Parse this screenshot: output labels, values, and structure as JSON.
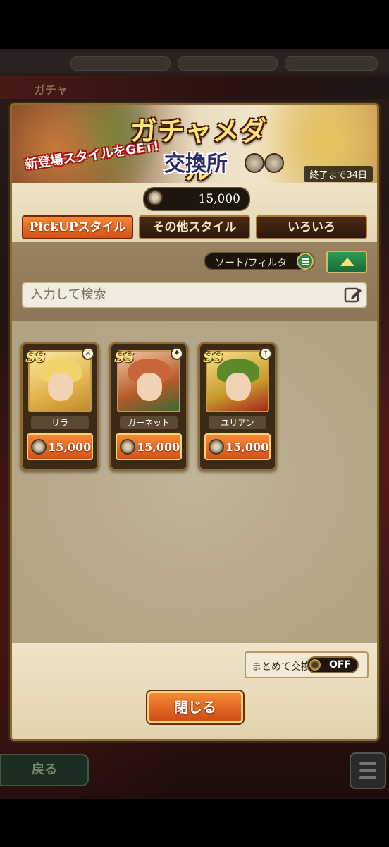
{
  "background": {
    "title": "ガチャ",
    "back_label": "戻る"
  },
  "banner": {
    "title": "ガチャメダル",
    "subtitle": "交換所",
    "promo": "新登場スタイルをGET!",
    "end_label": "終了まで34日"
  },
  "currency": {
    "icon": "medal-icon",
    "value": "15,000"
  },
  "tabs": [
    {
      "label": "PickUPスタイル",
      "active": true
    },
    {
      "label": "その他スタイル",
      "active": false
    },
    {
      "label": "いろいろ",
      "active": false
    }
  ],
  "filter": {
    "sort_label": "ソート/フィルタ",
    "search_placeholder": "入力して検索"
  },
  "items": [
    {
      "name": "リラ",
      "rank": "SS",
      "price": "15,000",
      "weapon_icon": "fan-icon"
    },
    {
      "name": "ガーネット",
      "rank": "SS",
      "price": "15,000",
      "weapon_icon": "staff-icon"
    },
    {
      "name": "ユリアン",
      "rank": "SS",
      "price": "15,000",
      "weapon_icon": "sword-icon"
    }
  ],
  "footer": {
    "bulk_label": "まとめて交換",
    "toggle_state": "OFF",
    "close_label": "閉じる"
  },
  "colors": {
    "accent": "#e86a26",
    "frame": "#8b6a37",
    "green": "#2f8a44"
  }
}
